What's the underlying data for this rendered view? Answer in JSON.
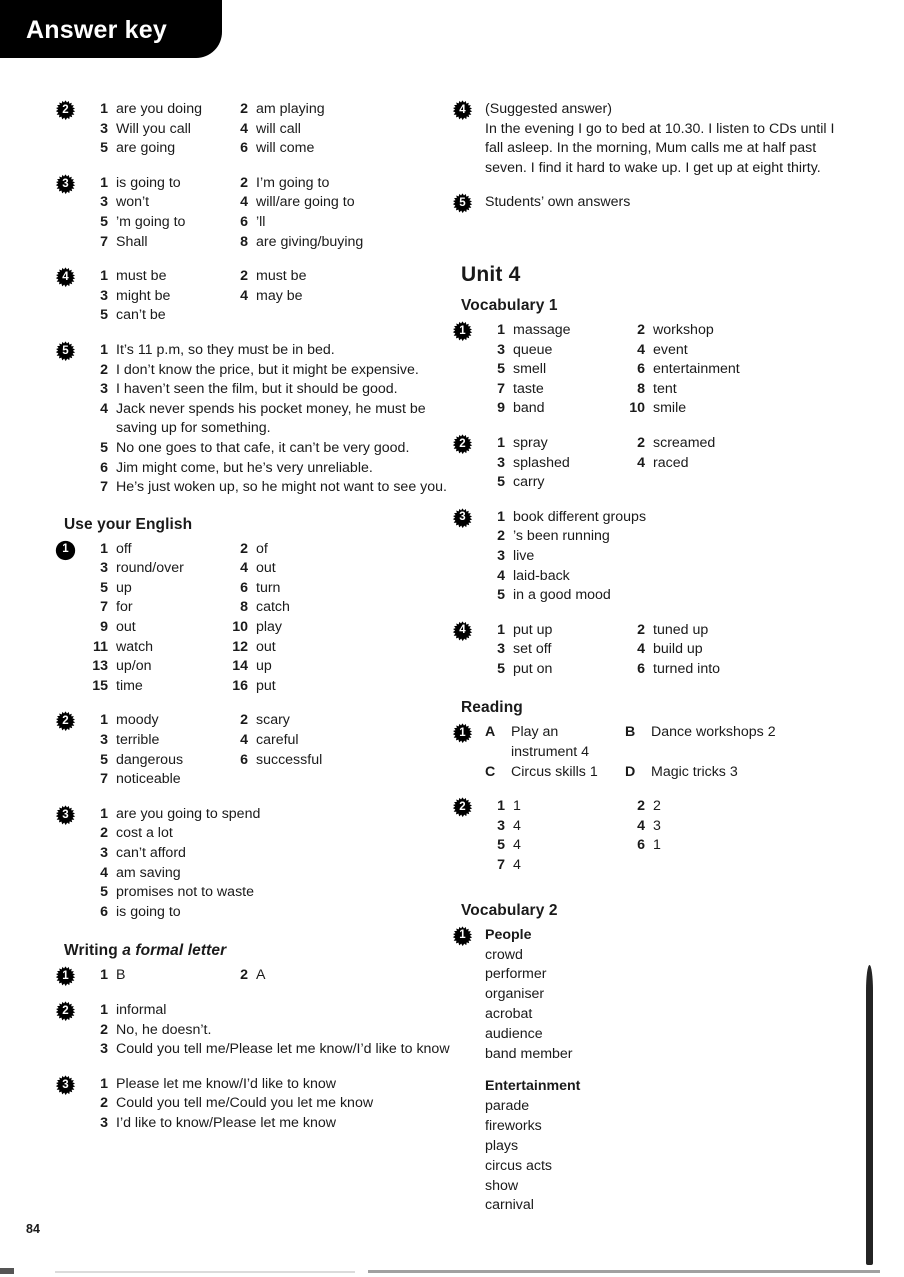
{
  "header": {
    "title": "Answer key"
  },
  "page_number": "84",
  "left_column": {
    "exercises": [
      {
        "badge": "2",
        "badge_style": "splat",
        "layout": "two-col",
        "items": [
          {
            "num": "1",
            "text": "are you doing"
          },
          {
            "num": "2",
            "text": "am playing"
          },
          {
            "num": "3",
            "text": "Will you call"
          },
          {
            "num": "4",
            "text": "will call"
          },
          {
            "num": "5",
            "text": "are going"
          },
          {
            "num": "6",
            "text": "will come"
          }
        ]
      },
      {
        "badge": "3",
        "badge_style": "splat",
        "layout": "two-col",
        "items": [
          {
            "num": "1",
            "text": "is going to"
          },
          {
            "num": "2",
            "text": "I’m going to"
          },
          {
            "num": "3",
            "text": "won’t"
          },
          {
            "num": "4",
            "text": "will/are going to"
          },
          {
            "num": "5",
            "text": "’m going to"
          },
          {
            "num": "6",
            "text": "’ll"
          },
          {
            "num": "7",
            "text": "Shall"
          },
          {
            "num": "8",
            "text": "are giving/buying"
          }
        ]
      },
      {
        "badge": "4",
        "badge_style": "splat",
        "layout": "two-col",
        "items": [
          {
            "num": "1",
            "text": "must be"
          },
          {
            "num": "2",
            "text": "must be"
          },
          {
            "num": "3",
            "text": "might be"
          },
          {
            "num": "4",
            "text": "may be"
          },
          {
            "num": "5",
            "text": "can’t be"
          }
        ]
      },
      {
        "badge": "5",
        "badge_style": "splat",
        "layout": "one-col",
        "items": [
          {
            "num": "1",
            "text": "It’s 11 p.m, so they must be in bed."
          },
          {
            "num": "2",
            "text": "I don’t know the price, but it might be expensive."
          },
          {
            "num": "3",
            "text": "I haven’t seen the film, but it should be good."
          },
          {
            "num": "4",
            "text": "Jack never spends his pocket money, he must be saving up for something."
          },
          {
            "num": "5",
            "text": "No one goes to that cafe, it can’t be very good."
          },
          {
            "num": "6",
            "text": "Jim might come, but he’s very unreliable."
          },
          {
            "num": "7",
            "text": "He’s just woken up, so he might not want to see you."
          }
        ]
      }
    ],
    "use_your_english": {
      "heading": "Use your English",
      "exercises": [
        {
          "badge": "1",
          "badge_style": "clean",
          "layout": "two-col",
          "items": [
            {
              "num": "1",
              "text": "off"
            },
            {
              "num": "2",
              "text": "of"
            },
            {
              "num": "3",
              "text": "round/over"
            },
            {
              "num": "4",
              "text": "out"
            },
            {
              "num": "5",
              "text": "up"
            },
            {
              "num": "6",
              "text": "turn"
            },
            {
              "num": "7",
              "text": "for"
            },
            {
              "num": "8",
              "text": "catch"
            },
            {
              "num": "9",
              "text": "out"
            },
            {
              "num": "10",
              "text": "play"
            },
            {
              "num": "11",
              "text": "watch"
            },
            {
              "num": "12",
              "text": "out"
            },
            {
              "num": "13",
              "text": "up/on"
            },
            {
              "num": "14",
              "text": "up"
            },
            {
              "num": "15",
              "text": "time"
            },
            {
              "num": "16",
              "text": "put"
            }
          ]
        },
        {
          "badge": "2",
          "badge_style": "splat",
          "layout": "two-col",
          "items": [
            {
              "num": "1",
              "text": "moody"
            },
            {
              "num": "2",
              "text": "scary"
            },
            {
              "num": "3",
              "text": "terrible"
            },
            {
              "num": "4",
              "text": "careful"
            },
            {
              "num": "5",
              "text": "dangerous"
            },
            {
              "num": "6",
              "text": "successful"
            },
            {
              "num": "7",
              "text": "noticeable"
            }
          ]
        },
        {
          "badge": "3",
          "badge_style": "splat",
          "layout": "one-col",
          "items": [
            {
              "num": "1",
              "text": "are you going to spend"
            },
            {
              "num": "2",
              "text": "cost a lot"
            },
            {
              "num": "3",
              "text": "can’t afford"
            },
            {
              "num": "4",
              "text": "am saving"
            },
            {
              "num": "5",
              "text": "promises not to waste"
            },
            {
              "num": "6",
              "text": "is going to"
            }
          ]
        }
      ]
    },
    "writing": {
      "heading_regular": "Writing ",
      "heading_italic": "a formal letter",
      "exercises": [
        {
          "badge": "1",
          "badge_style": "splat",
          "layout": "two-col",
          "items": [
            {
              "num": "1",
              "text": "B"
            },
            {
              "num": "2",
              "text": "A"
            }
          ]
        },
        {
          "badge": "2",
          "badge_style": "splat",
          "layout": "one-col",
          "items": [
            {
              "num": "1",
              "text": "informal"
            },
            {
              "num": "2",
              "text": "No, he doesn’t."
            },
            {
              "num": "3",
              "text": "Could you tell me/Please let me know/I’d like to know"
            }
          ]
        },
        {
          "badge": "3",
          "badge_style": "splat",
          "layout": "one-col",
          "items": [
            {
              "num": "1",
              "text": "Please let me know/I’d like to know"
            },
            {
              "num": "2",
              "text": "Could you tell me/Could you let me know"
            },
            {
              "num": "3",
              "text": "I’d like to know/Please let me know"
            }
          ]
        }
      ]
    }
  },
  "right_column": {
    "top_exercises": [
      {
        "badge": "4",
        "badge_style": "splat",
        "layout": "paragraph",
        "lead": "(Suggested answer)",
        "paragraph": "In the evening I go to bed at 10.30. I listen to CDs until I fall asleep. In the morning, Mum calls me at half past seven. I find it hard to wake up. I get up at eight thirty."
      },
      {
        "badge": "5",
        "badge_style": "splat",
        "layout": "paragraph",
        "paragraph": "Students’ own answers"
      }
    ],
    "unit": {
      "heading": "Unit 4"
    },
    "vocabulary_1": {
      "heading": "Vocabulary 1",
      "exercises": [
        {
          "badge": "1",
          "badge_style": "splat",
          "layout": "two-col",
          "items": [
            {
              "num": "1",
              "text": "massage"
            },
            {
              "num": "2",
              "text": "workshop"
            },
            {
              "num": "3",
              "text": "queue"
            },
            {
              "num": "4",
              "text": "event"
            },
            {
              "num": "5",
              "text": "smell"
            },
            {
              "num": "6",
              "text": "entertainment"
            },
            {
              "num": "7",
              "text": "taste"
            },
            {
              "num": "8",
              "text": "tent"
            },
            {
              "num": "9",
              "text": "band"
            },
            {
              "num": "10",
              "text": "smile"
            }
          ]
        },
        {
          "badge": "2",
          "badge_style": "splat",
          "layout": "two-col",
          "items": [
            {
              "num": "1",
              "text": "spray"
            },
            {
              "num": "2",
              "text": "screamed"
            },
            {
              "num": "3",
              "text": "splashed"
            },
            {
              "num": "4",
              "text": "raced"
            },
            {
              "num": "5",
              "text": "carry"
            }
          ]
        },
        {
          "badge": "3",
          "badge_style": "splat",
          "layout": "one-col",
          "items": [
            {
              "num": "1",
              "text": "book different groups"
            },
            {
              "num": "2",
              "text": "’s been running"
            },
            {
              "num": "3",
              "text": "live"
            },
            {
              "num": "4",
              "text": "laid-back"
            },
            {
              "num": "5",
              "text": "in a good mood"
            }
          ]
        },
        {
          "badge": "4",
          "badge_style": "splat",
          "layout": "two-col",
          "items": [
            {
              "num": "1",
              "text": "put up"
            },
            {
              "num": "2",
              "text": "tuned up"
            },
            {
              "num": "3",
              "text": "set off"
            },
            {
              "num": "4",
              "text": "build up"
            },
            {
              "num": "5",
              "text": "put on"
            },
            {
              "num": "6",
              "text": "turned into"
            }
          ]
        }
      ]
    },
    "reading": {
      "heading": "Reading",
      "exercises": [
        {
          "badge": "1",
          "badge_style": "splat",
          "layout": "two-col-letters",
          "items": [
            {
              "num": "A",
              "text": "Play an instrument 4"
            },
            {
              "num": "B",
              "text": "Dance workshops 2"
            },
            {
              "num": "C",
              "text": "Circus skills 1"
            },
            {
              "num": "D",
              "text": "Magic tricks 3"
            }
          ]
        },
        {
          "badge": "2",
          "badge_style": "splat",
          "layout": "two-col",
          "items": [
            {
              "num": "1",
              "text": "1"
            },
            {
              "num": "2",
              "text": "2"
            },
            {
              "num": "3",
              "text": "4"
            },
            {
              "num": "4",
              "text": "3"
            },
            {
              "num": "5",
              "text": "4"
            },
            {
              "num": "6",
              "text": "1"
            },
            {
              "num": "7",
              "text": "4"
            }
          ]
        }
      ]
    },
    "vocabulary_2": {
      "heading": "Vocabulary 2",
      "badge": "1",
      "badge_style": "splat",
      "groups": [
        {
          "title": "People",
          "words": [
            "crowd",
            "performer",
            "organiser",
            "acrobat",
            "audience",
            "band member"
          ]
        },
        {
          "title": "Entertainment",
          "words": [
            "parade",
            "fireworks",
            "plays",
            "circus acts",
            "show",
            "carnival"
          ]
        }
      ]
    }
  }
}
